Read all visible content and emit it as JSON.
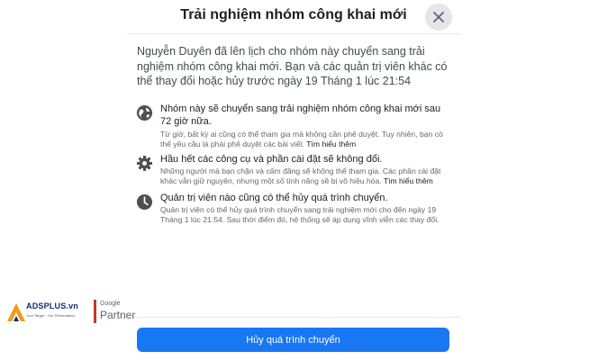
{
  "dialog": {
    "title": "Trải nghiệm nhóm công khai mới",
    "intro": "Nguyễn Duyên đã lên lịch cho nhóm này chuyển sang trải nghiệm nhóm công khai mới. Bạn và các quản trị viên khác có thể thay đổi hoặc hủy trước ngày 19 Tháng 1 lúc 21:54",
    "features": [
      {
        "icon": "globe-icon",
        "title": "Nhóm này sẽ chuyển sang trải nghiệm nhóm công khai mới sau 72 giờ nữa.",
        "desc": "Từ giờ, bất kỳ ai cũng có thể tham gia mà không cần phê duyệt. Tuy nhiên, bạn có thể yêu cầu là phải phê duyệt các bài viết.",
        "link": "Tìm hiểu thêm"
      },
      {
        "icon": "gear-icon",
        "title": "Hầu hết các công cụ và phần cài đặt sẽ không đổi.",
        "desc": "Những người mà bạn chặn và cấm đăng sẽ không thể tham gia. Các phần cài đặt khác vẫn giữ nguyên, nhưng một số tính năng sẽ bị vô hiệu hóa.",
        "link": "Tìm hiểu thêm"
      },
      {
        "icon": "clock-icon",
        "title": "Quản trị viên nào cũng có thể hủy quá trình chuyển.",
        "desc": "Quản trị viên có thể hủy quá trình chuyển sang trải nghiệm mới cho đến ngày 19 Tháng 1 lúc 21:54. Sau thời điểm đó, hệ thống sẽ áp dụng vĩnh viễn các thay đổi.",
        "link": ""
      }
    ],
    "primary_button": "Hủy quá trình chuyển",
    "close_icon": "close-icon"
  },
  "watermark": {
    "brand": "ADSPLUS.vn",
    "tagline": "Your Target · Our Performance",
    "google": "Google",
    "partner": "Partner"
  },
  "colors": {
    "primary": "#1877f2",
    "icon_dark": "#4b4f56",
    "brand_orange": "#f39c12",
    "brand_navy": "#1a2a6c",
    "brand_red": "#c0392b"
  }
}
